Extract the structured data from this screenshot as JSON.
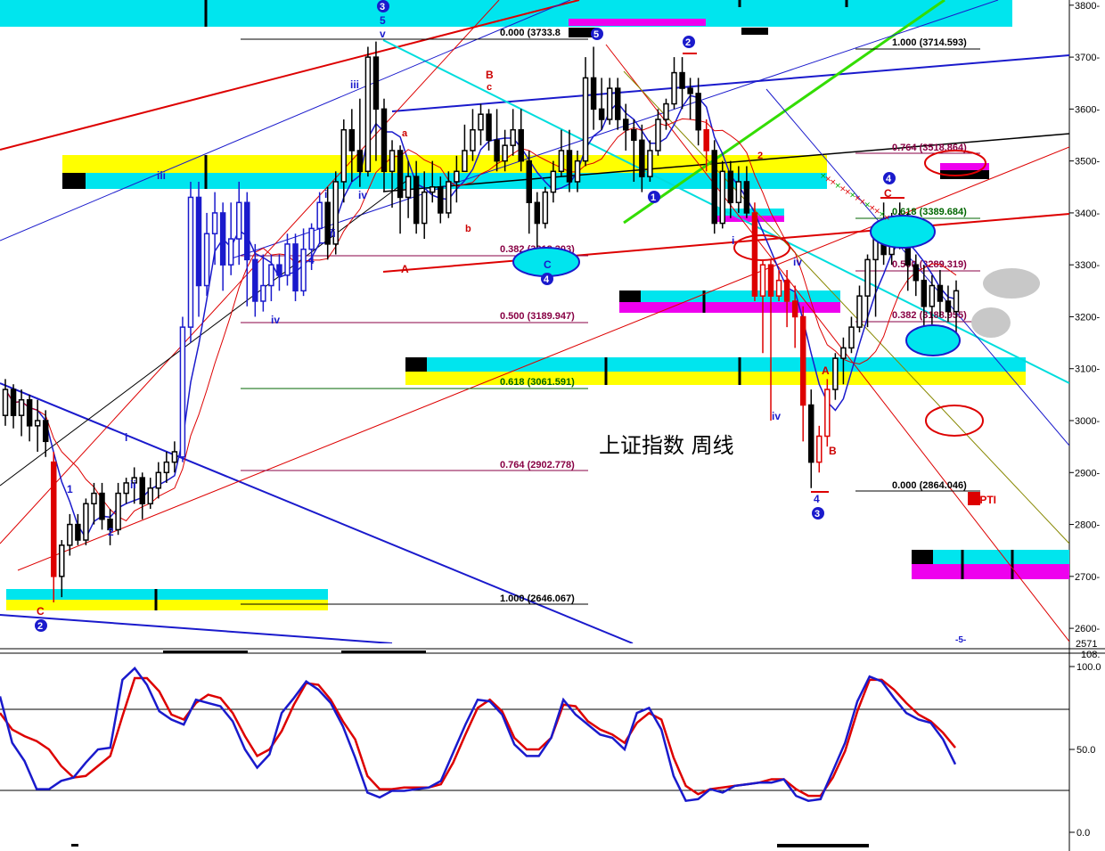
{
  "chart_data": {
    "type": "candlestick",
    "title": "上证指数 周线",
    "price_axis": {
      "ylim": [
        2571,
        3810
      ],
      "ticks": [
        3800,
        3700,
        3600,
        3500,
        3400,
        3300,
        3200,
        3100,
        3000,
        2900,
        2800,
        2700,
        2600
      ],
      "tick_labels": [
        "3800-",
        "3700-",
        "3600-",
        "3500-",
        "3400-",
        "3300-",
        "3200-",
        "3100-",
        "3000-",
        "2900-",
        "2800-",
        "2700-",
        "2600-"
      ],
      "bottom_label": "2571"
    },
    "fib_retracements": [
      {
        "label": "0.000 (3733.8",
        "color": "#000000"
      },
      {
        "label": "0.382 (3318.303)",
        "color": "#880044"
      },
      {
        "label": "0.500 (3189.947)",
        "color": "#880044"
      },
      {
        "label": "0.618 (3061.591)",
        "color": "#006600"
      },
      {
        "label": "0.764 (2902.778)",
        "color": "#880044"
      },
      {
        "label": "1.000 (2646.067)",
        "color": "#000000"
      }
    ],
    "fib_retracements_right": [
      {
        "label": "1.000 (3714.593)",
        "color": "#000000"
      },
      {
        "label": "0.764 (3518.864)",
        "color": "#880044"
      },
      {
        "label": "0.618 (3389.684)",
        "color": "#006600"
      },
      {
        "label": "0.500 (3289.319)",
        "color": "#880044"
      },
      {
        "label": "0.382 (3188.955)",
        "color": "#880044"
      },
      {
        "label": "0.000 (2864.046)",
        "color": "#000000"
      }
    ],
    "wave_labels_blue": [
      "3",
      "5",
      "v",
      "iii",
      "iv",
      "iii",
      "iv",
      "4",
      "i",
      "ii",
      "1",
      "2",
      "i",
      "ii",
      "2",
      "5",
      "2",
      "1",
      "4",
      "3",
      "4",
      "i",
      "iv",
      "iv",
      "C",
      "4",
      "5"
    ],
    "wave_labels_red": [
      "B",
      "c",
      "a",
      "b",
      "A",
      "C",
      "2",
      "1",
      "3",
      "4",
      "5",
      "A",
      "B",
      "C"
    ],
    "annotation": "16PTI",
    "annotation_bottom": "-5-",
    "indicator": {
      "ylim": [
        -5,
        105
      ],
      "ticks": [
        100,
        50,
        0
      ],
      "tick_labels": [
        "100.0",
        "50.0",
        "0.0"
      ],
      "top_label": "108.",
      "levels": [
        80,
        20
      ],
      "k_values": [
        82,
        54,
        43,
        26,
        26,
        31,
        33,
        42,
        50,
        51,
        92,
        99,
        89,
        73,
        68,
        65,
        80,
        78,
        76,
        67,
        50,
        39,
        47,
        72,
        81,
        91,
        86,
        78,
        64,
        45,
        24,
        21,
        25,
        25,
        26,
        27,
        31,
        48,
        65,
        80,
        79,
        71,
        53,
        46,
        46,
        57,
        80,
        71,
        65,
        59,
        57,
        50,
        72,
        75,
        62,
        34,
        19,
        20,
        26,
        24,
        28,
        29,
        30,
        30,
        32,
        22,
        19,
        20,
        37,
        54,
        79,
        94,
        91,
        81,
        72,
        68,
        66,
        56,
        41
      ],
      "d_values": [
        72,
        62,
        58,
        55,
        50,
        40,
        33,
        34,
        40,
        46,
        70,
        93,
        93,
        85,
        71,
        68,
        78,
        83,
        81,
        72,
        58,
        46,
        50,
        61,
        77,
        90,
        89,
        80,
        67,
        56,
        34,
        26,
        26,
        27,
        27,
        27,
        29,
        42,
        59,
        75,
        80,
        73,
        57,
        50,
        50,
        57,
        77,
        76,
        67,
        62,
        59,
        54,
        66,
        72,
        68,
        45,
        28,
        23,
        26,
        27,
        28,
        29,
        30,
        32,
        32,
        26,
        22,
        22,
        33,
        49,
        73,
        92,
        92,
        86,
        78,
        71,
        67,
        60,
        51
      ]
    },
    "series": [
      {
        "name": "price",
        "values": [
          [
            3010,
            3060,
            2990,
            3080
          ],
          [
            3060,
            3010,
            2985,
            3070
          ],
          [
            3010,
            3040,
            2970,
            3060
          ],
          [
            3040,
            2990,
            2960,
            3050
          ],
          [
            2990,
            3000,
            2940,
            3040
          ],
          [
            3000,
            2960,
            2930,
            3020
          ],
          [
            2920,
            2700,
            2650,
            2940
          ],
          [
            2700,
            2760,
            2660,
            2770
          ],
          [
            2760,
            2800,
            2740,
            2820
          ],
          [
            2800,
            2770,
            2760,
            2820
          ],
          [
            2770,
            2840,
            2760,
            2850
          ],
          [
            2840,
            2860,
            2800,
            2880
          ],
          [
            2860,
            2810,
            2790,
            2880
          ],
          [
            2810,
            2790,
            2760,
            2830
          ],
          [
            2790,
            2860,
            2780,
            2880
          ],
          [
            2860,
            2880,
            2840,
            2890
          ],
          [
            2880,
            2890,
            2840,
            2910
          ],
          [
            2890,
            2840,
            2810,
            2900
          ],
          [
            2840,
            2870,
            2830,
            2890
          ],
          [
            2870,
            2900,
            2850,
            2920
          ],
          [
            2900,
            2920,
            2880,
            2940
          ],
          [
            2920,
            2940,
            2900,
            2960
          ],
          [
            2930,
            3180,
            2920,
            3200
          ],
          [
            3180,
            3430,
            3150,
            3460
          ],
          [
            3430,
            3260,
            3200,
            3460
          ],
          [
            3260,
            3360,
            3240,
            3400
          ],
          [
            3360,
            3400,
            3300,
            3440
          ],
          [
            3400,
            3300,
            3250,
            3420
          ],
          [
            3300,
            3350,
            3280,
            3420
          ],
          [
            3350,
            3420,
            3300,
            3460
          ],
          [
            3420,
            3310,
            3220,
            3440
          ],
          [
            3310,
            3230,
            3200,
            3340
          ],
          [
            3230,
            3260,
            3210,
            3320
          ],
          [
            3260,
            3300,
            3230,
            3320
          ],
          [
            3300,
            3280,
            3250,
            3320
          ],
          [
            3280,
            3340,
            3260,
            3360
          ],
          [
            3340,
            3250,
            3230,
            3360
          ],
          [
            3250,
            3330,
            3240,
            3370
          ],
          [
            3330,
            3370,
            3290,
            3380
          ],
          [
            3370,
            3420,
            3340,
            3440
          ],
          [
            3420,
            3340,
            3310,
            3450
          ],
          [
            3340,
            3460,
            3320,
            3480
          ],
          [
            3460,
            3560,
            3420,
            3580
          ],
          [
            3560,
            3520,
            3460,
            3600
          ],
          [
            3520,
            3480,
            3450,
            3620
          ],
          [
            3480,
            3700,
            3470,
            3720
          ],
          [
            3700,
            3600,
            3500,
            3730
          ],
          [
            3600,
            3480,
            3440,
            3620
          ],
          [
            3480,
            3520,
            3410,
            3540
          ],
          [
            3520,
            3430,
            3360,
            3530
          ],
          [
            3430,
            3470,
            3390,
            3500
          ],
          [
            3470,
            3380,
            3360,
            3500
          ],
          [
            3380,
            3440,
            3350,
            3480
          ],
          [
            3440,
            3450,
            3420,
            3500
          ],
          [
            3450,
            3400,
            3380,
            3470
          ],
          [
            3400,
            3460,
            3390,
            3480
          ],
          [
            3460,
            3480,
            3420,
            3510
          ],
          [
            3480,
            3520,
            3480,
            3570
          ],
          [
            3520,
            3560,
            3500,
            3600
          ],
          [
            3560,
            3590,
            3530,
            3610
          ],
          [
            3590,
            3540,
            3520,
            3600
          ],
          [
            3540,
            3500,
            3480,
            3600
          ],
          [
            3500,
            3530,
            3480,
            3560
          ],
          [
            3530,
            3560,
            3510,
            3600
          ],
          [
            3560,
            3500,
            3480,
            3600
          ],
          [
            3500,
            3420,
            3360,
            3520
          ],
          [
            3420,
            3380,
            3320,
            3440
          ],
          [
            3380,
            3440,
            3370,
            3450
          ],
          [
            3440,
            3480,
            3420,
            3500
          ],
          [
            3480,
            3520,
            3470,
            3560
          ],
          [
            3520,
            3460,
            3440,
            3560
          ],
          [
            3460,
            3500,
            3440,
            3520
          ],
          [
            3500,
            3660,
            3490,
            3700
          ],
          [
            3660,
            3600,
            3560,
            3720
          ],
          [
            3600,
            3580,
            3560,
            3660
          ],
          [
            3580,
            3640,
            3570,
            3660
          ],
          [
            3640,
            3580,
            3560,
            3660
          ],
          [
            3580,
            3560,
            3520,
            3610
          ],
          [
            3560,
            3540,
            3460,
            3580
          ],
          [
            3540,
            3470,
            3440,
            3570
          ],
          [
            3470,
            3520,
            3460,
            3540
          ],
          [
            3520,
            3580,
            3510,
            3600
          ],
          [
            3580,
            3610,
            3560,
            3620
          ],
          [
            3610,
            3670,
            3600,
            3700
          ],
          [
            3670,
            3640,
            3600,
            3700
          ],
          [
            3640,
            3630,
            3580,
            3660
          ],
          [
            3630,
            3560,
            3530,
            3660
          ],
          [
            3560,
            3520,
            3480,
            3580
          ],
          [
            3520,
            3380,
            3360,
            3540
          ],
          [
            3380,
            3480,
            3370,
            3500
          ],
          [
            3480,
            3420,
            3390,
            3500
          ],
          [
            3420,
            3460,
            3400,
            3490
          ],
          [
            3460,
            3400,
            3390,
            3490
          ],
          [
            3400,
            3240,
            3230,
            3420
          ],
          [
            3240,
            3300,
            3130,
            3310
          ],
          [
            3300,
            3240,
            3000,
            3310
          ],
          [
            3240,
            3270,
            3230,
            3290
          ],
          [
            3270,
            3230,
            3180,
            3290
          ],
          [
            3230,
            3200,
            3140,
            3260
          ],
          [
            3200,
            3030,
            2960,
            3220
          ],
          [
            3030,
            2920,
            2870,
            3060
          ],
          [
            2920,
            2970,
            2900,
            2990
          ],
          [
            2970,
            3060,
            2950,
            3080
          ],
          [
            3060,
            3120,
            3040,
            3130
          ],
          [
            3120,
            3140,
            3070,
            3160
          ],
          [
            3140,
            3180,
            3130,
            3200
          ],
          [
            3180,
            3240,
            3170,
            3260
          ],
          [
            3240,
            3310,
            3180,
            3320
          ],
          [
            3310,
            3360,
            3200,
            3380
          ],
          [
            3360,
            3320,
            3300,
            3420
          ],
          [
            3320,
            3380,
            3300,
            3400
          ],
          [
            3380,
            3360,
            3330,
            3420
          ],
          [
            3360,
            3300,
            3250,
            3400
          ],
          [
            3300,
            3270,
            3240,
            3320
          ],
          [
            3270,
            3220,
            3160,
            3300
          ],
          [
            3220,
            3260,
            3180,
            3280
          ],
          [
            3260,
            3230,
            3200,
            3290
          ],
          [
            3230,
            3210,
            3190,
            3260
          ],
          [
            3210,
            3250,
            3170,
            3270
          ]
        ]
      }
    ]
  }
}
